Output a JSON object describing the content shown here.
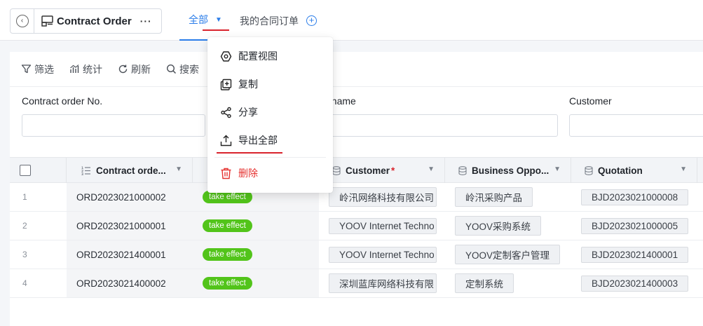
{
  "header": {
    "title": "Contract Order",
    "more": "···",
    "tabs": [
      {
        "label": "全部"
      },
      {
        "label": "我的合同订单"
      }
    ]
  },
  "toolbar": {
    "filter": "筛选",
    "stats": "统计",
    "refresh": "刷新",
    "search": "搜索"
  },
  "filters": [
    {
      "label": "Contract order No.",
      "value": ""
    },
    {
      "label": "t name",
      "value": ""
    },
    {
      "label": "Customer",
      "value": ""
    }
  ],
  "table": {
    "columns": [
      {
        "label": "Contract orde..."
      },
      {
        "label": "Customer",
        "required": "*"
      },
      {
        "label": "Business Oppo..."
      },
      {
        "label": "Quotation"
      }
    ],
    "rows": [
      {
        "num": "1",
        "order": "ORD2023021000002",
        "status": "take effect",
        "customer": "岭汛网络科技有限公司",
        "opportunity": "岭汛采购产品",
        "quotation": "BJD2023021000008"
      },
      {
        "num": "2",
        "order": "ORD2023021000001",
        "status": "take effect",
        "customer": "YOOV Internet Techno",
        "opportunity": "YOOV采购系统",
        "quotation": "BJD2023021000005"
      },
      {
        "num": "3",
        "order": "ORD2023021400001",
        "status": "take effect",
        "customer": "YOOV Internet Techno",
        "opportunity": "YOOV定制客户管理",
        "quotation": "BJD2023021400001"
      },
      {
        "num": "4",
        "order": "ORD2023021400002",
        "status": "take effect",
        "customer": "深圳蓝库网络科技有限",
        "opportunity": "定制系统",
        "quotation": "BJD2023021400003"
      }
    ]
  },
  "dropdown": {
    "items": [
      {
        "label": "配置视图",
        "icon": "hexagon-gear-icon"
      },
      {
        "label": "复制",
        "icon": "copy-icon"
      },
      {
        "label": "分享",
        "icon": "share-icon"
      },
      {
        "label": "导出全部",
        "icon": "export-icon"
      },
      {
        "label": "删除",
        "icon": "trash-icon"
      }
    ]
  },
  "colors": {
    "accent": "#2b7de9",
    "status_green": "#52c41a",
    "danger": "#e5312f",
    "annotation_red": "#d9232d"
  }
}
